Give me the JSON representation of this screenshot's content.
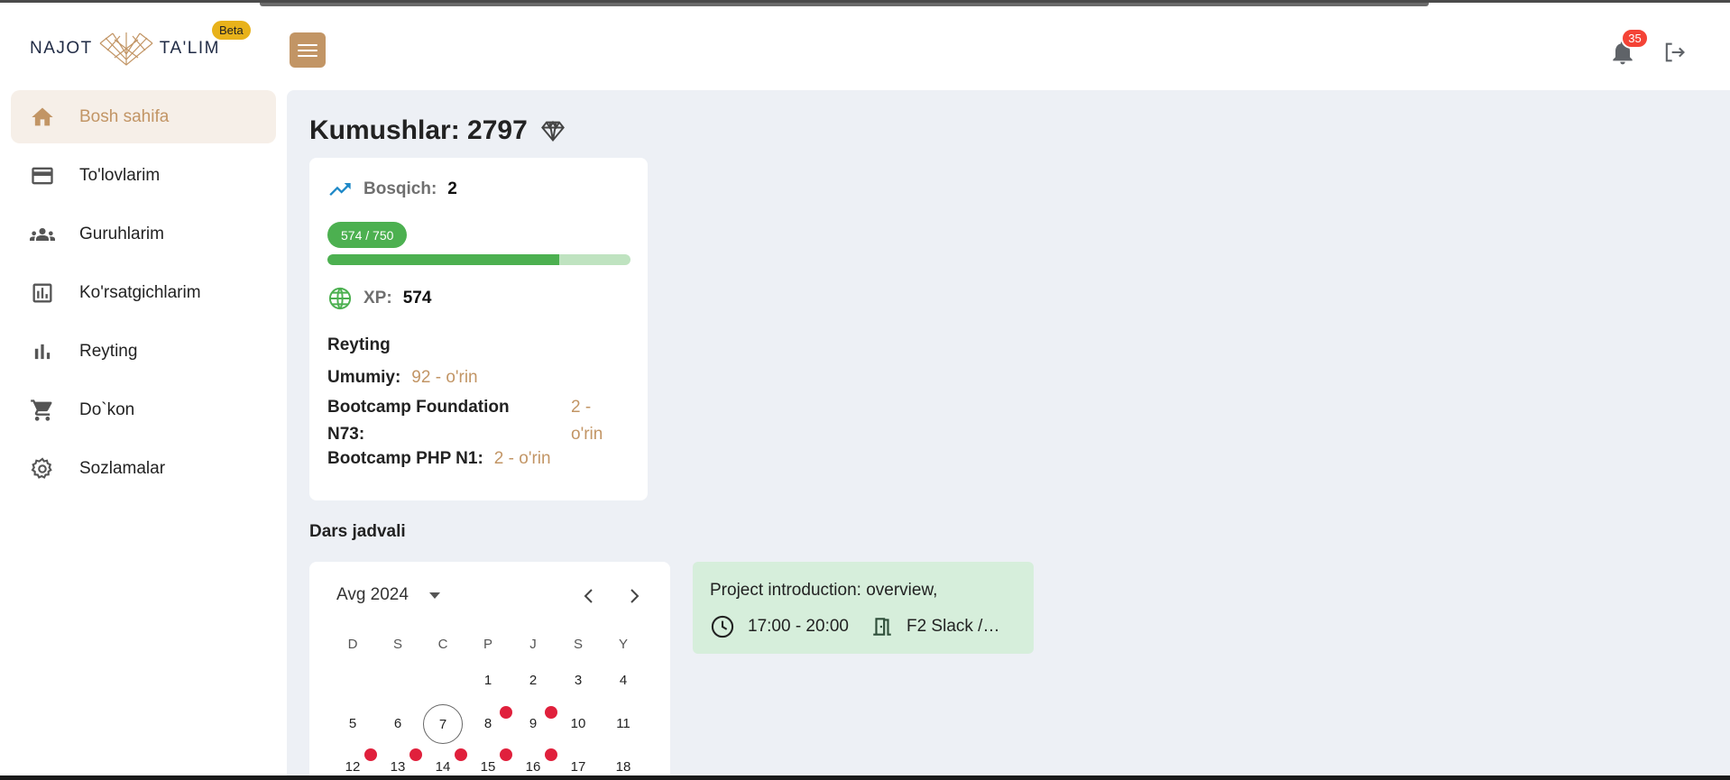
{
  "brand": {
    "left": "NAJOT",
    "right": "TA'LIM",
    "beta": "Beta"
  },
  "header": {
    "notification_count": "35"
  },
  "sidebar": {
    "items": [
      {
        "label": "Bosh sahifa",
        "icon": "home-icon",
        "active": true
      },
      {
        "label": "To'lovlarim",
        "icon": "credit-card-icon"
      },
      {
        "label": "Guruhlarim",
        "icon": "groups-icon"
      },
      {
        "label": "Ko'rsatgichlarim",
        "icon": "analytics-icon"
      },
      {
        "label": "Reyting",
        "icon": "bar-chart-icon"
      },
      {
        "label": "Do`kon",
        "icon": "shopping-cart-icon"
      },
      {
        "label": "Sozlamalar",
        "icon": "gear-icon"
      }
    ]
  },
  "main": {
    "coins_title": "Kumushlar: 2797",
    "stage_label": "Bosqich:",
    "stage_value": "2",
    "progress_text": "574 / 750",
    "progress_value": 574,
    "progress_max": 750,
    "xp_label": "XP:",
    "xp_value": "574",
    "rating_title": "Reyting",
    "ratings": [
      {
        "label": "Umumiy:",
        "value": "92 - o'rin"
      },
      {
        "label_line1": "Bootcamp Foundation",
        "label_line2": "N73:",
        "value_line1": "2 -",
        "value_line2": "o'rin"
      },
      {
        "label": "Bootcamp PHP N1:",
        "value": "2 - o'rin"
      }
    ],
    "schedule_title": "Dars jadvali"
  },
  "calendar": {
    "month_label": "Avg 2024",
    "weekdays": [
      "D",
      "S",
      "C",
      "P",
      "J",
      "S",
      "Y"
    ],
    "week1": [
      "1",
      "2",
      "3",
      "4"
    ],
    "week2": [
      "5",
      "6",
      "7",
      "8",
      "9",
      "10",
      "11"
    ],
    "week3": [
      "12",
      "13",
      "14",
      "15",
      "16",
      "17",
      "18"
    ],
    "today": "7"
  },
  "lesson": {
    "title": "Project introduction: overview,",
    "time": "17:00 - 20:00",
    "room": "F2 Slack /…"
  },
  "colors": {
    "accent": "#c29565",
    "success": "#4cb050",
    "badge": "#f44336",
    "dot": "#e0203c"
  }
}
